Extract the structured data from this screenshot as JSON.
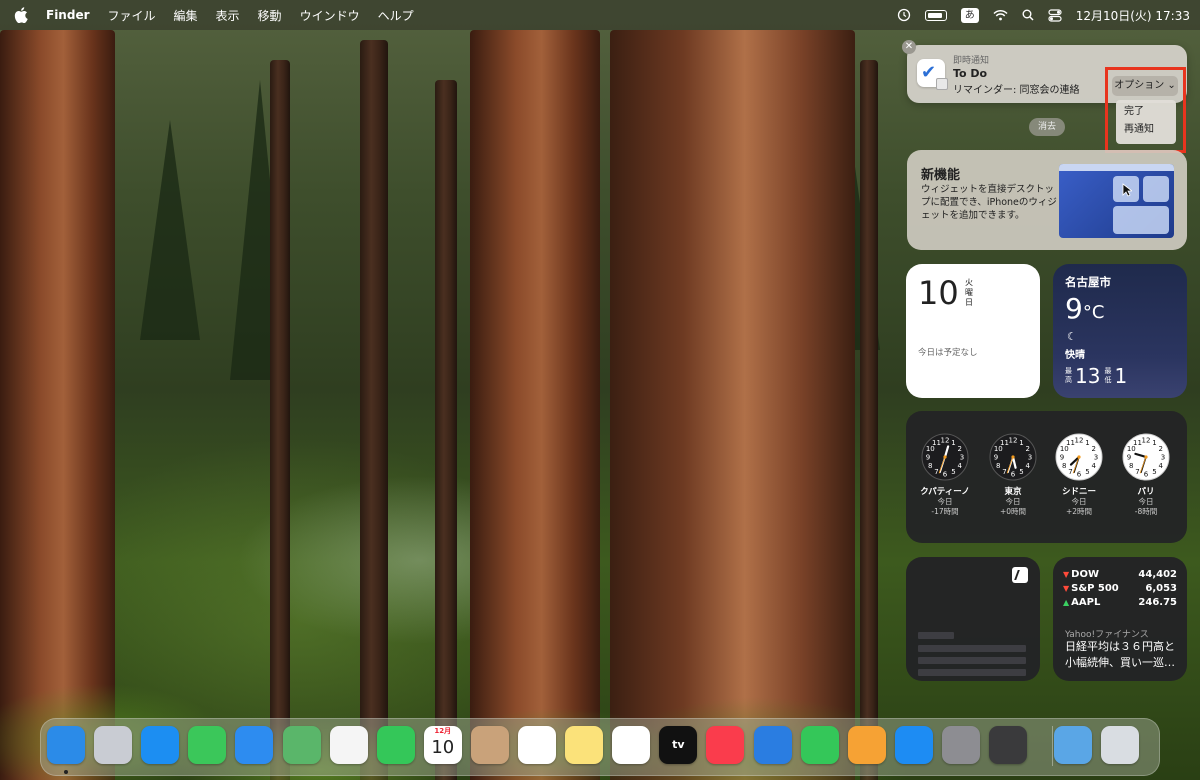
{
  "menubar": {
    "app": "Finder",
    "menus": [
      "ファイル",
      "編集",
      "表示",
      "移動",
      "ウインドウ",
      "ヘルプ"
    ],
    "input_mode": "あ",
    "datetime": "12月10日(火) 17:33"
  },
  "notification": {
    "kind": "即時通知",
    "title": "To Do",
    "body": "リマインダー: 同窓会の連絡",
    "options_label": "オプション",
    "options_items": [
      "完了",
      "再通知"
    ],
    "clear_label": "消去",
    "close_glyph": "✕"
  },
  "new_feature": {
    "title": "新機能",
    "description": "ウィジェットを直接デスクトップに配置でき、iPhoneのウィジェットを追加できます。"
  },
  "calendar": {
    "day": "10",
    "weekday": "火曜日",
    "empty": "今日は予定なし"
  },
  "weather": {
    "city": "名古屋市",
    "temp": "9",
    "unit": "°C",
    "condition": "快晴",
    "high_label": "最高",
    "high": "13",
    "low_label": "最低",
    "low": "1"
  },
  "world_clock": [
    {
      "city": "クパティーノ",
      "day": "今日",
      "offset": "-17時間",
      "theme": "dark",
      "hour": 0.55,
      "minute": 33
    },
    {
      "city": "東京",
      "day": "今日",
      "offset": "+0時間",
      "theme": "dark",
      "hour": 17.55,
      "minute": 33
    },
    {
      "city": "シドニー",
      "day": "今日",
      "offset": "+2時間",
      "theme": "light",
      "hour": 19.55,
      "minute": 33
    },
    {
      "city": "パリ",
      "day": "今日",
      "offset": "-8時間",
      "theme": "light",
      "hour": 9.55,
      "minute": 33
    }
  ],
  "stocks": {
    "rows": [
      {
        "symbol": "DOW",
        "value": "44,402",
        "dir": "down"
      },
      {
        "symbol": "S&P 500",
        "value": "6,053",
        "dir": "down"
      },
      {
        "symbol": "AAPL",
        "value": "246.75",
        "dir": "up"
      }
    ],
    "source": "Yahoo!ファイナンス",
    "headline": "日経平均は３６円高と小幅続伸、買い一巡…"
  },
  "dock": {
    "apps": [
      {
        "name": "finder",
        "color": "#2b8be8",
        "label": "",
        "running": true
      },
      {
        "name": "launchpad",
        "color": "#c9ccd3",
        "label": ""
      },
      {
        "name": "safari",
        "color": "#1c8ef2",
        "label": ""
      },
      {
        "name": "messages",
        "color": "#3bc75a",
        "label": ""
      },
      {
        "name": "mail",
        "color": "#2d8cf0",
        "label": ""
      },
      {
        "name": "maps",
        "color": "#5ab66a",
        "label": ""
      },
      {
        "name": "photos",
        "color": "#f5f5f5",
        "label": ""
      },
      {
        "name": "facetime",
        "color": "#34c759",
        "label": ""
      },
      {
        "name": "calendar",
        "color": "#ffffff",
        "label": "10"
      },
      {
        "name": "contacts",
        "color": "#c9a27a",
        "label": ""
      },
      {
        "name": "reminders",
        "color": "#ffffff",
        "label": ""
      },
      {
        "name": "notes",
        "color": "#fbe27a",
        "label": ""
      },
      {
        "name": "freeform",
        "color": "#ffffff",
        "label": ""
      },
      {
        "name": "tv",
        "color": "#111111",
        "label": "tv"
      },
      {
        "name": "music",
        "color": "#fa3c4c",
        "label": ""
      },
      {
        "name": "keynote",
        "color": "#2a7de1",
        "label": ""
      },
      {
        "name": "numbers",
        "color": "#34c759",
        "label": ""
      },
      {
        "name": "pages",
        "color": "#f6a234",
        "label": ""
      },
      {
        "name": "app-store",
        "color": "#1d8cf3",
        "label": ""
      },
      {
        "name": "system-settings",
        "color": "#8d8d92",
        "label": ""
      },
      {
        "name": "iphone-mirroring",
        "color": "#3a3a3c",
        "label": ""
      },
      {
        "name": "downloads",
        "color": "#5aa6e6",
        "label": ""
      },
      {
        "name": "trash",
        "color": "#d9dde2",
        "label": ""
      }
    ],
    "calendar_month": "12月"
  }
}
